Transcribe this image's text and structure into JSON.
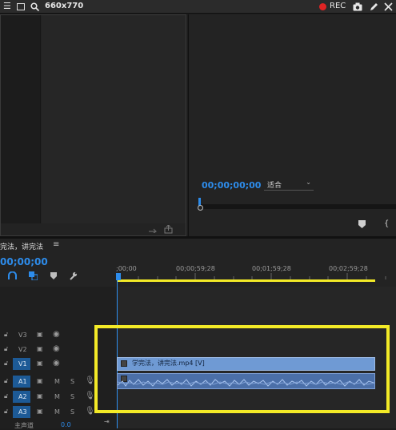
{
  "window": {
    "title": "660x770",
    "rec_label": "REC"
  },
  "program_monitor": {
    "timecode": "00;00;00;00",
    "fit_label": "适合"
  },
  "sequence": {
    "name": "完法，讲完法",
    "menu_icon": "≡",
    "playhead_timecode": "00;00;00",
    "ruler_labels": [
      ";00;00",
      "00;00;59;28",
      "00;01;59;28",
      "00;02;59;28"
    ]
  },
  "tracks": {
    "video": [
      {
        "id": "V3"
      },
      {
        "id": "V2"
      },
      {
        "id": "V1"
      }
    ],
    "audio": [
      {
        "id": "A1",
        "m": "M",
        "s": "S"
      },
      {
        "id": "A2",
        "m": "M",
        "s": "S"
      },
      {
        "id": "A3",
        "m": "M",
        "s": "S"
      }
    ],
    "master_label": "主声道",
    "master_value": "0.0"
  },
  "clips": {
    "video_clip_label": "学完法，讲完法.mp4 [V]"
  },
  "colors": {
    "accent_blue": "#2d8ceb",
    "highlight_yellow": "#f3ea27",
    "clip_blue": "#6f9ad4",
    "rec_red": "#e02424"
  }
}
